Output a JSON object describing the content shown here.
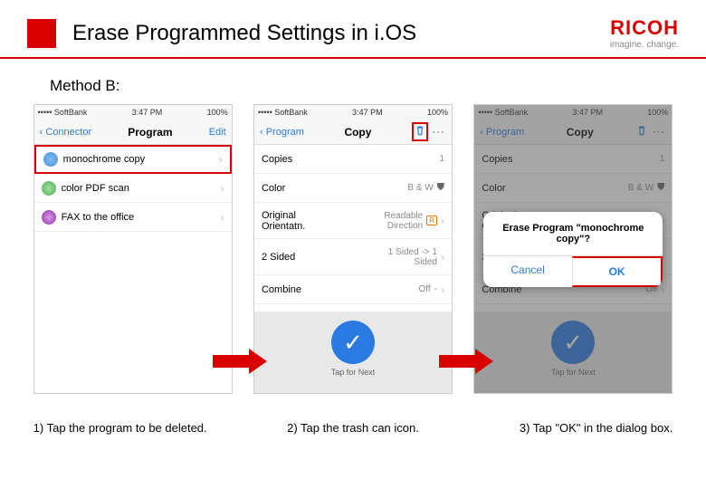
{
  "header": {
    "title": "Erase Programmed Settings in i.OS",
    "logo": "RICOH",
    "tagline": "imagine. change."
  },
  "method_label": "Method B:",
  "status": {
    "carrier": "••••• SoftBank",
    "time": "3:47 PM",
    "battery": "100%"
  },
  "screen1": {
    "back": "‹ Connector",
    "title": "Program",
    "edit": "Edit",
    "items": [
      {
        "label": "monochrome copy"
      },
      {
        "label": "color PDF scan"
      },
      {
        "label": "FAX to the office"
      }
    ]
  },
  "screen2": {
    "back": "‹ Program",
    "title": "Copy",
    "rows": {
      "copies": {
        "label": "Copies",
        "value": "1"
      },
      "color": {
        "label": "Color",
        "value": "B & W"
      },
      "orient": {
        "label": "Original Orientatn.",
        "value": "Readable Direction"
      },
      "twosided": {
        "label": "2 Sided",
        "value": "1 Sided -> 1 Sided"
      },
      "combine": {
        "label": "Combine",
        "value": "Off"
      }
    },
    "tap_next": "Tap for Next"
  },
  "screen3": {
    "dialog_msg": "Erase Program \"monochrome copy\"?",
    "cancel": "Cancel",
    "ok": "OK"
  },
  "captions": {
    "c1": "1) Tap the program to be deleted.",
    "c2": "2) Tap the trash can icon.",
    "c3": "3) Tap \"OK\" in the dialog box."
  }
}
